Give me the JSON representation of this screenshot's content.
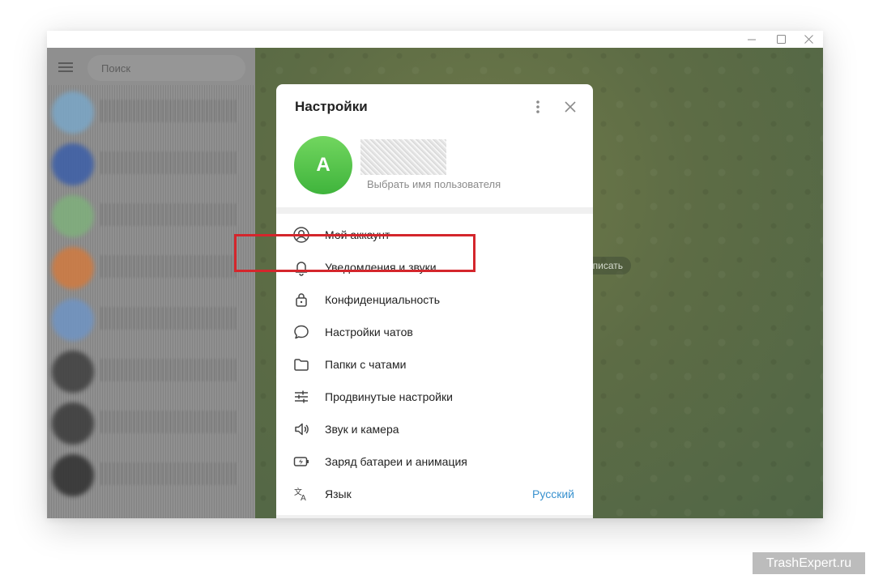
{
  "window": {
    "controls": [
      "minimize",
      "maximize",
      "close"
    ]
  },
  "left_pane": {
    "search": {
      "placeholder": "Поиск",
      "value": ""
    },
    "chat_rows": [
      {
        "avatar_color": "#7aa7c8"
      },
      {
        "avatar_color": "#3b5ea8"
      },
      {
        "avatar_color": "#7fb07c"
      },
      {
        "avatar_color": "#d17a3f"
      },
      {
        "avatar_color": "#6f94c4"
      },
      {
        "avatar_color": "#3e3e3e"
      },
      {
        "avatar_color": "#3a3a3a"
      },
      {
        "avatar_color": "#2f2f2f"
      }
    ]
  },
  "chat_area": {
    "pill_text": "аписать"
  },
  "settings": {
    "title": "Настройки",
    "profile": {
      "avatar_letter": "A",
      "username_prompt": "Выбрать имя пользователя"
    },
    "menu": [
      {
        "icon": "account-icon",
        "label": "Мой аккаунт"
      },
      {
        "icon": "bell-icon",
        "label": "Уведомления и звуки"
      },
      {
        "icon": "lock-icon",
        "label": "Конфиденциальность"
      },
      {
        "icon": "chat-bubble-icon",
        "label": "Настройки чатов"
      },
      {
        "icon": "folder-icon",
        "label": "Папки с чатами"
      },
      {
        "icon": "sliders-icon",
        "label": "Продвинутые настройки"
      },
      {
        "icon": "speaker-icon",
        "label": "Звук и камера"
      },
      {
        "icon": "battery-icon",
        "label": "Заряд батареи и анимация"
      },
      {
        "icon": "translate-icon",
        "label": "Язык",
        "value": "Русский"
      }
    ]
  },
  "annotation": {
    "highlight_color": "#d4262c",
    "highlighted_item": "Конфиденциальность"
  },
  "colors": {
    "accent": "#3a92cf",
    "avatar_green": "#4cbb45"
  },
  "watermark": "TrashExpert.ru"
}
